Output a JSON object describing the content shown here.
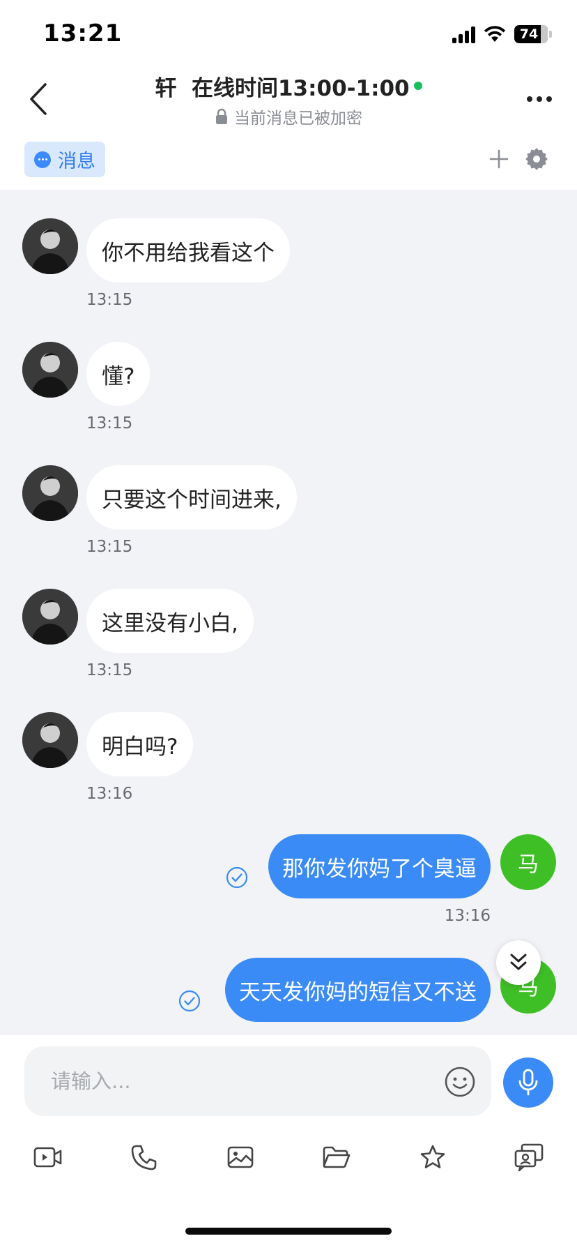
{
  "status_bar": {
    "time": "13:21",
    "battery": "74"
  },
  "header": {
    "title": "轩  在线时间13:00-1:00",
    "subtitle": "当前消息已被加密"
  },
  "tabs": {
    "messages_label": "消息"
  },
  "messages": [
    {
      "direction": "in",
      "text": "你不用给我看这个",
      "time": "13:15"
    },
    {
      "direction": "in",
      "text": "懂?",
      "time": "13:15"
    },
    {
      "direction": "in",
      "text": "只要这个时间进来,",
      "time": "13:15"
    },
    {
      "direction": "in",
      "text": "这里没有小白,",
      "time": "13:15"
    },
    {
      "direction": "in",
      "text": "明白吗?",
      "time": "13:16"
    },
    {
      "direction": "out",
      "text": "那你发你妈了个臭逼",
      "time": "13:16",
      "avatar_label": "马"
    },
    {
      "direction": "out",
      "text": "天天发你妈的短信又不送",
      "avatar_label": "马"
    }
  ],
  "input": {
    "placeholder": "请输入..."
  },
  "toolbar": [
    "video-icon",
    "phone-icon",
    "image-icon",
    "folder-icon",
    "star-icon",
    "screen-share-icon"
  ],
  "colors": {
    "accent": "#3b8bf6",
    "online": "#15c15d",
    "avatar_out": "#3fbf26",
    "chat_bg": "#f2f3f6"
  }
}
